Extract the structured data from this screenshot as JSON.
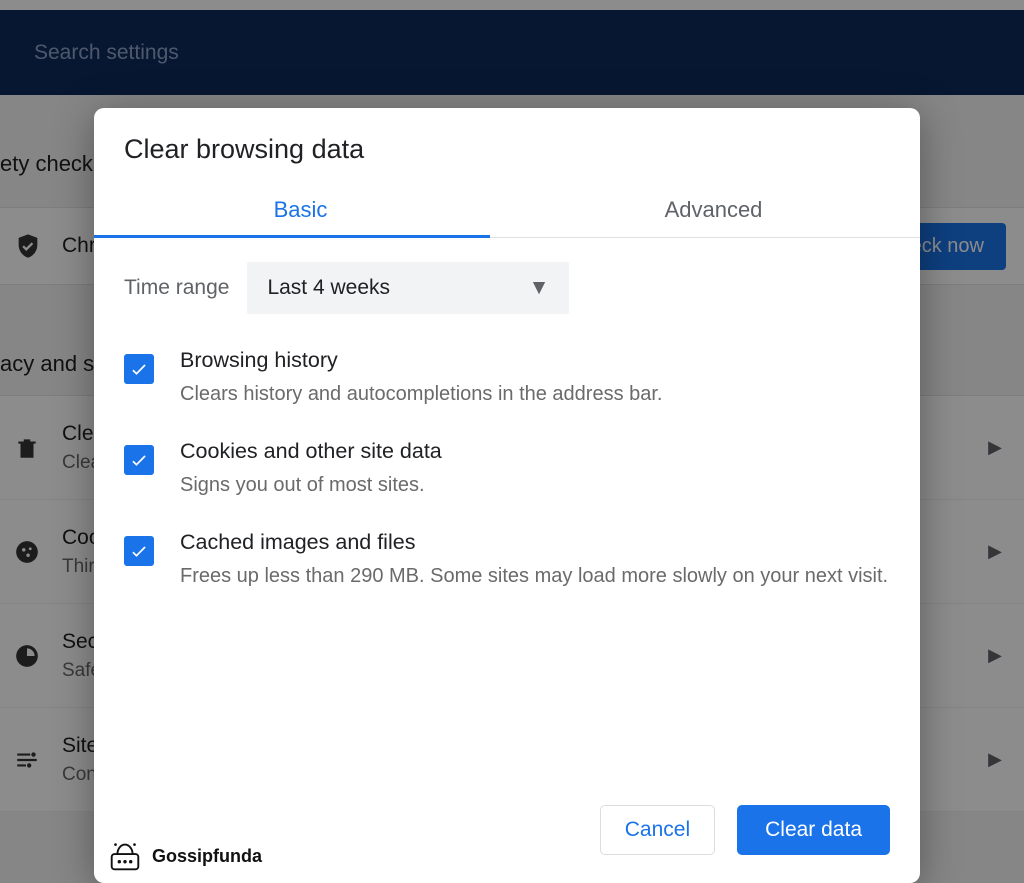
{
  "header": {
    "search_placeholder": "Search settings"
  },
  "sections": {
    "safety": {
      "heading": "ety check",
      "row_text": "Chro",
      "button": "eck now"
    },
    "privacy": {
      "heading": "acy and s",
      "items": [
        {
          "title": "Clear",
          "sub": "Clear"
        },
        {
          "title": "Cook",
          "sub": "Third"
        },
        {
          "title": "Secu",
          "sub": "Safe"
        },
        {
          "title": "Site ",
          "sub": "Cont"
        }
      ]
    }
  },
  "dialog": {
    "title": "Clear browsing data",
    "tabs": {
      "basic": "Basic",
      "advanced": "Advanced"
    },
    "time_range_label": "Time range",
    "time_range_value": "Last 4 weeks",
    "options": [
      {
        "title": "Browsing history",
        "desc": "Clears history and autocompletions in the address bar.",
        "checked": true
      },
      {
        "title": "Cookies and other site data",
        "desc": "Signs you out of most sites.",
        "checked": true
      },
      {
        "title": "Cached images and files",
        "desc": "Frees up less than 290 MB. Some sites may load more slowly on your next visit.",
        "checked": true
      }
    ],
    "cancel": "Cancel",
    "confirm": "Clear data"
  },
  "watermark": "Gossipfunda"
}
